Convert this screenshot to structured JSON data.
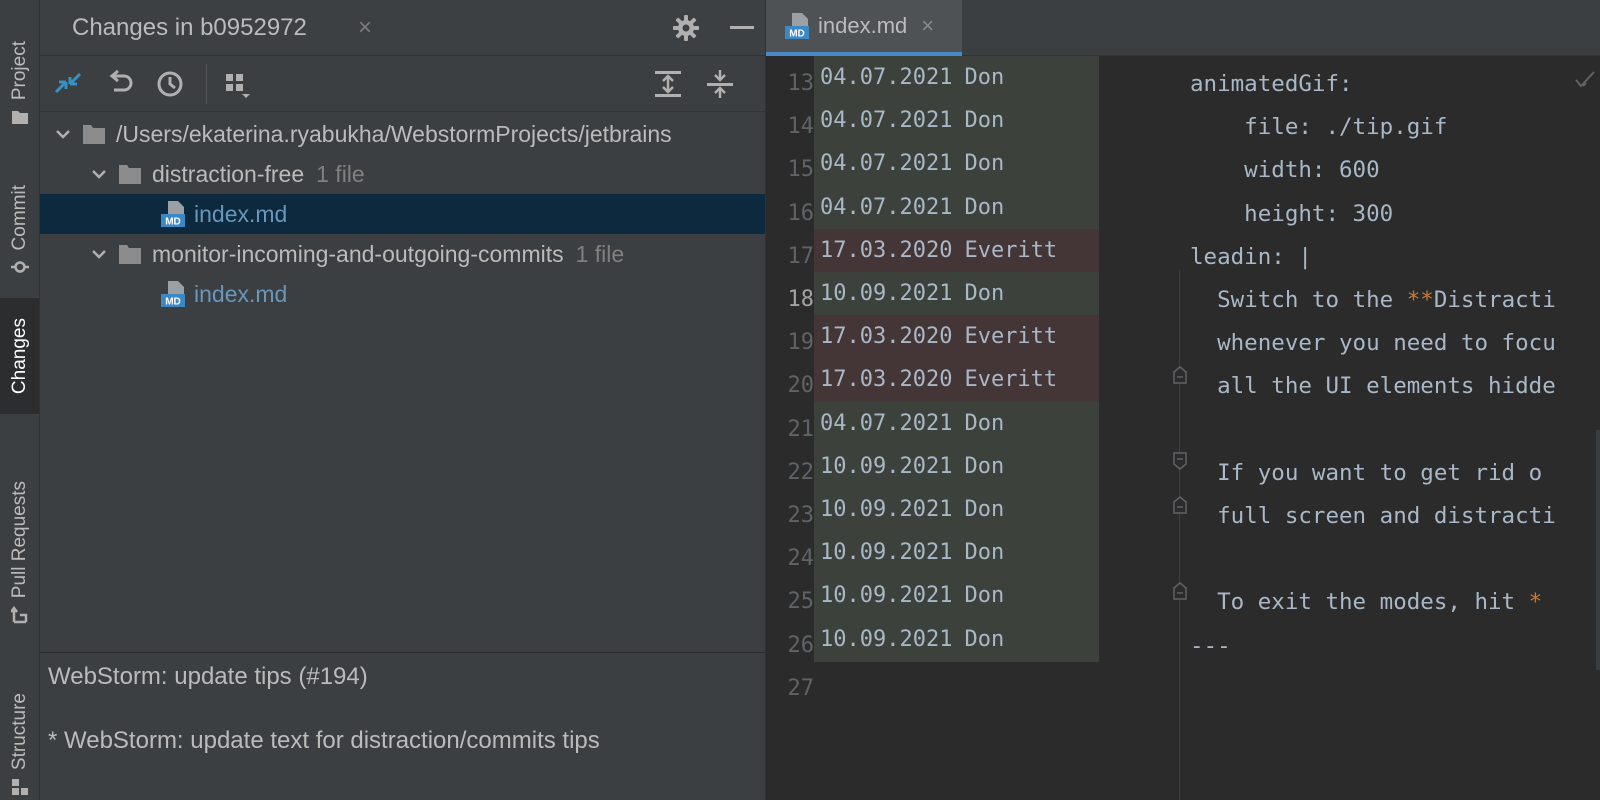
{
  "tool_stripe": {
    "items": [
      {
        "label": "Project",
        "icon": "folder-icon"
      },
      {
        "label": "Commit",
        "icon": "commit-icon"
      },
      {
        "label": "Changes",
        "icon": "none",
        "active": true
      },
      {
        "label": "Pull Requests",
        "icon": "pull-request-icon"
      },
      {
        "label": "Structure",
        "icon": "structure-icon"
      }
    ]
  },
  "changes_panel": {
    "title": "Changes in b0952972",
    "close_glyph": "×",
    "header_icons": [
      "gear-icon",
      "minimize-icon"
    ],
    "toolbar_icons": [
      "compare-arrows-icon",
      "revert-icon",
      "history-icon",
      "group-by-icon",
      "expand-all-icon",
      "collapse-all-icon"
    ],
    "tree": {
      "root": "/Users/ekaterina.ryabukha/WebstormProjects/jetbrains",
      "groups": [
        {
          "folder": "distraction-free",
          "count": "1 file",
          "files": [
            "index.md"
          ]
        },
        {
          "folder": "monitor-incoming-and-outgoing-commits",
          "count": "1 file",
          "files": [
            "index.md"
          ]
        }
      ]
    },
    "commit_message": {
      "subject": "WebStorm: update tips (#194)",
      "body": "* WebStorm: update text for distraction/commits tips"
    }
  },
  "editor": {
    "tab": {
      "label": "index.md",
      "close_glyph": "×",
      "icon": "markdown-file-icon",
      "icon_text": "MD"
    },
    "gutter": [
      {
        "line": "13",
        "date": "04.07.2021",
        "author": "Don"
      },
      {
        "line": "14",
        "date": "04.07.2021",
        "author": "Don"
      },
      {
        "line": "15",
        "date": "04.07.2021",
        "author": "Don"
      },
      {
        "line": "16",
        "date": "04.07.2021",
        "author": "Don"
      },
      {
        "line": "17",
        "date": "17.03.2020",
        "author": "Everitt"
      },
      {
        "line": "18",
        "date": "10.09.2021",
        "author": "Don"
      },
      {
        "line": "19",
        "date": "17.03.2020",
        "author": "Everitt"
      },
      {
        "line": "20",
        "date": "17.03.2020",
        "author": "Everitt"
      },
      {
        "line": "21",
        "date": "04.07.2021",
        "author": "Don"
      },
      {
        "line": "22",
        "date": "10.09.2021",
        "author": "Don"
      },
      {
        "line": "23",
        "date": "10.09.2021",
        "author": "Don"
      },
      {
        "line": "24",
        "date": "10.09.2021",
        "author": "Don"
      },
      {
        "line": "25",
        "date": "10.09.2021",
        "author": "Don"
      },
      {
        "line": "26",
        "date": "10.09.2021",
        "author": "Don"
      },
      {
        "line": "27",
        "date": "",
        "author": ""
      }
    ],
    "current_line": "18",
    "code_lines": [
      {
        "pre": "animatedGif:",
        "bold": "",
        "post": ""
      },
      {
        "pre": "    file: ./tip.gif",
        "bold": "",
        "post": ""
      },
      {
        "pre": "    width: 600",
        "bold": "",
        "post": ""
      },
      {
        "pre": "    height: 300",
        "bold": "",
        "post": ""
      },
      {
        "pre": "leadin: |",
        "bold": "",
        "post": ""
      },
      {
        "pre": "  Switch to the ",
        "bold": "**",
        "post": "Distracti"
      },
      {
        "pre": "  whenever you need to focu",
        "bold": "",
        "post": ""
      },
      {
        "pre": "  all the UI elements hidde",
        "bold": "",
        "post": ""
      },
      {
        "pre": "",
        "bold": "",
        "post": ""
      },
      {
        "pre": "  If you want to get rid o",
        "bold": "",
        "post": ""
      },
      {
        "pre": "  full screen and distracti",
        "bold": "",
        "post": ""
      },
      {
        "pre": "",
        "bold": "",
        "post": ""
      },
      {
        "pre": "  To exit the modes, hit ",
        "bold": "*",
        "post": ""
      },
      {
        "pre": "---",
        "bold": "",
        "post": ""
      },
      {
        "pre": "",
        "bold": "",
        "post": ""
      }
    ]
  },
  "colors": {
    "accent": "#4a88c7",
    "file_link": "#6897bb",
    "selection": "#0d293e",
    "annot_don": "#3c423b",
    "annot_everitt": "#443637",
    "markdown_bold": "#cc7832"
  }
}
